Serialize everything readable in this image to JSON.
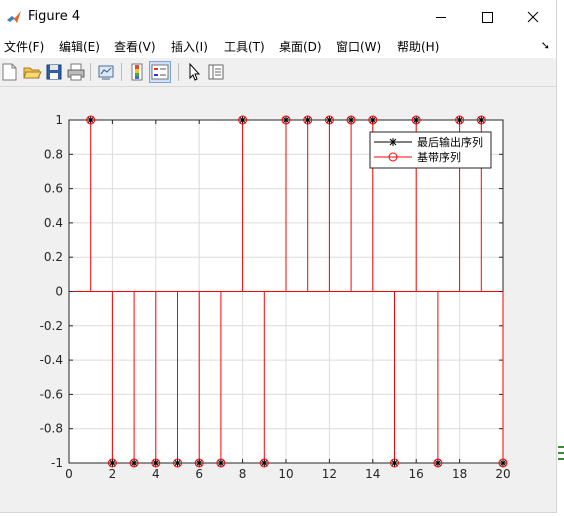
{
  "window": {
    "title": "Figure 4"
  },
  "menus": [
    "文件(F)",
    "编辑(E)",
    "查看(V)",
    "插入(I)",
    "工具(T)",
    "桌面(D)",
    "窗口(W)",
    "帮助(H)"
  ],
  "toolbar_icons": [
    "new-figure-icon",
    "open-file-icon",
    "save-icon",
    "print-icon",
    "link-plot-icon",
    "insert-colorbar-icon",
    "insert-legend-icon",
    "edit-plot-icon",
    "property-inspector-icon"
  ],
  "colors": {
    "series1": "#000000",
    "series2": "#ff0000",
    "grid": "#dcdcdc"
  },
  "chart_data": {
    "type": "stem",
    "title": "",
    "xlabel": "",
    "ylabel": "",
    "xlim": [
      0,
      20
    ],
    "ylim": [
      -1,
      1
    ],
    "xticks": [
      0,
      2,
      4,
      6,
      8,
      10,
      12,
      14,
      16,
      18,
      20
    ],
    "yticks": [
      1,
      0.8,
      0.6,
      0.4,
      0.2,
      0,
      -0.2,
      -0.4,
      -0.6,
      -0.8,
      -1
    ],
    "grid": true,
    "legend_position": "top-right",
    "x": [
      1,
      2,
      3,
      4,
      5,
      6,
      7,
      8,
      9,
      10,
      11,
      12,
      13,
      14,
      15,
      16,
      17,
      18,
      19,
      20
    ],
    "series": [
      {
        "name": "最后输出序列",
        "marker": "*",
        "color": "#000000",
        "values": [
          1,
          -1,
          -1,
          -1,
          -1,
          -1,
          -1,
          1,
          -1,
          1,
          1,
          1,
          1,
          1,
          -1,
          1,
          -1,
          1,
          1,
          -1
        ]
      },
      {
        "name": "基带序列",
        "marker": "o",
        "color": "#ff0000",
        "values": [
          1,
          -1,
          -1,
          -1,
          -1,
          -1,
          -1,
          1,
          -1,
          1,
          1,
          1,
          1,
          1,
          -1,
          1,
          -1,
          1,
          1,
          -1
        ]
      }
    ]
  }
}
